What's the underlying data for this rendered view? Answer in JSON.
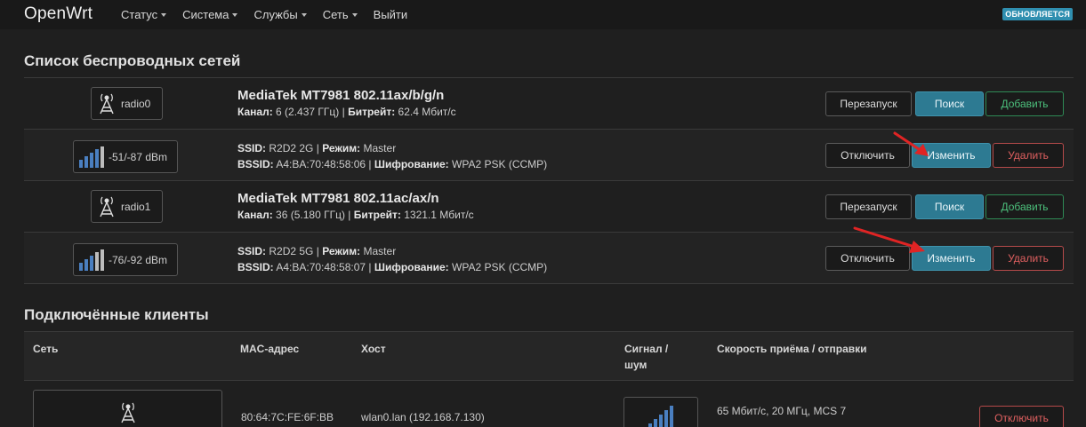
{
  "navbar": {
    "brand": "OpenWrt",
    "menu": [
      {
        "label": "Статус",
        "dropdown": true
      },
      {
        "label": "Система",
        "dropdown": true
      },
      {
        "label": "Службы",
        "dropdown": true
      },
      {
        "label": "Сеть",
        "dropdown": true
      },
      {
        "label": "Выйти",
        "dropdown": false
      }
    ],
    "status_badge": "ОБНОВЛЯЕТСЯ"
  },
  "wireless": {
    "title": "Список беспроводных сетей",
    "radios": [
      {
        "device": "radio0",
        "name": "MediaTek MT7981 802.11ax/b/g/n",
        "channel_label": "Канал:",
        "channel": "6 (2.437 ГГц)",
        "bitrate_label": "Битрейт:",
        "bitrate": "62.4 Мбит/с",
        "buttons": {
          "restart": "Перезапуск",
          "scan": "Поиск",
          "add": "Добавить"
        },
        "network": {
          "signal": "-51/-87 dBm",
          "signal_bars": 4,
          "ssid_label": "SSID:",
          "ssid": "R2D2 2G",
          "mode_label": "Режим:",
          "mode": "Master",
          "bssid_label": "BSSID:",
          "bssid": "A4:BA:70:48:58:06",
          "enc_label": "Шифрование:",
          "enc": "WPA2 PSK (CCMP)",
          "buttons": {
            "disable": "Отключить",
            "edit": "Изменить",
            "remove": "Удалить"
          }
        }
      },
      {
        "device": "radio1",
        "name": "MediaTek MT7981 802.11ac/ax/n",
        "channel_label": "Канал:",
        "channel": "36 (5.180 ГГц)",
        "bitrate_label": "Битрейт:",
        "bitrate": "1321.1 Мбит/с",
        "buttons": {
          "restart": "Перезапуск",
          "scan": "Поиск",
          "add": "Добавить"
        },
        "network": {
          "signal": "-76/-92 dBm",
          "signal_bars": 3,
          "ssid_label": "SSID:",
          "ssid": "R2D2 5G",
          "mode_label": "Режим:",
          "mode": "Master",
          "bssid_label": "BSSID:",
          "bssid": "A4:BA:70:48:58:07",
          "enc_label": "Шифрование:",
          "enc": "WPA2 PSK (CCMP)",
          "buttons": {
            "disable": "Отключить",
            "edit": "Изменить",
            "remove": "Удалить"
          }
        }
      }
    ]
  },
  "clients": {
    "title": "Подключённые клиенты",
    "columns": {
      "network": "Сеть",
      "mac": "MAC-адрес",
      "host": "Хост",
      "signal_l1": "Сигнал /",
      "signal_l2": "шум",
      "rate": "Скорость приёма / отправки"
    },
    "rows": [
      {
        "mac": "80:64:7C:FE:6F:BB",
        "host": "wlan0.lan (192.168.7.130)",
        "rate": "65 Мбит/с, 20 МГц, MCS 7",
        "disconnect": "Отключить"
      }
    ]
  },
  "colors": {
    "accent": "#2d7a92",
    "positive": "#4cc07c",
    "negative": "#e06060",
    "annotation_arrow": "#e02424"
  }
}
